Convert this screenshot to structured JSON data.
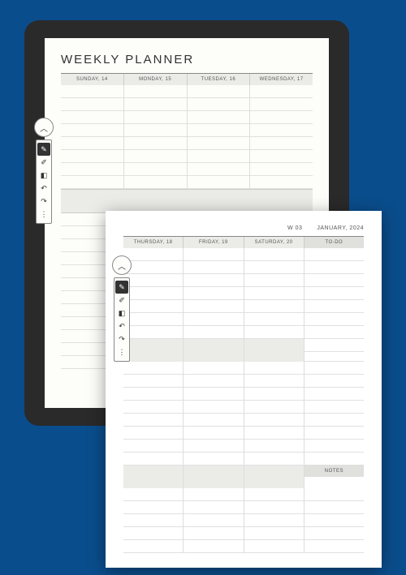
{
  "page1": {
    "title": "WEEKLY PLANNER",
    "days": [
      "SUNDAY, 14",
      "MONDAY, 15",
      "TUESDAY, 16",
      "WEDNESDAY, 17"
    ]
  },
  "page2": {
    "week": "W 03",
    "month": "JANUARY, 2024",
    "days": [
      "THURSDAY, 18",
      "FRIDAY, 19",
      "SATURDAY, 20"
    ],
    "todo_label": "TO-DO",
    "notes_label": "NOTES"
  },
  "toolbar": {
    "collapse": "︿",
    "pen": "✎",
    "marker": "✐",
    "eraser": "◧",
    "undo": "↶",
    "redo": "↷",
    "more": "⋮"
  }
}
